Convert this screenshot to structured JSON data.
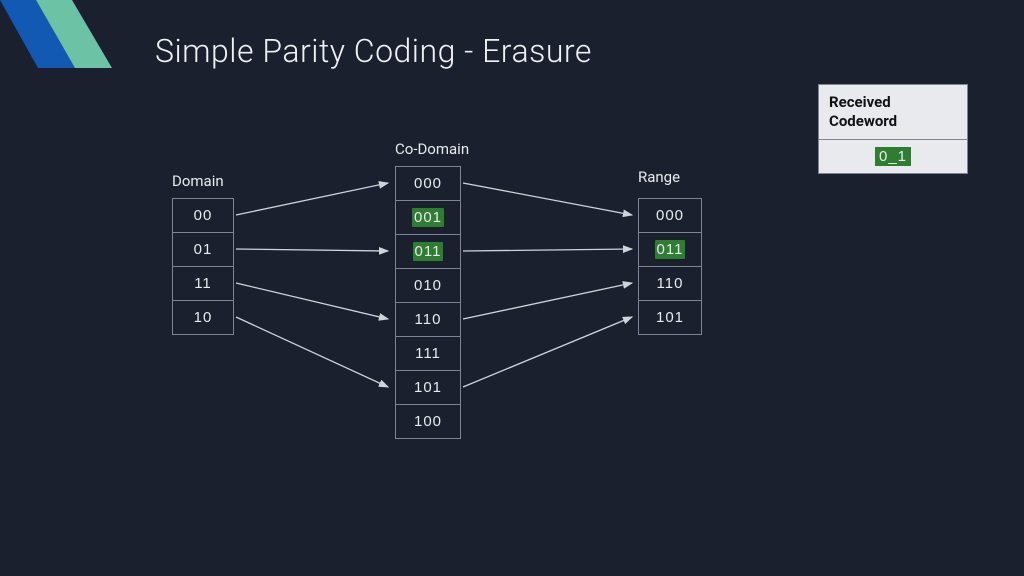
{
  "title": "Simple Parity Coding - Erasure",
  "labels": {
    "domain": "Domain",
    "codomain": "Co-Domain",
    "range": "Range"
  },
  "received": {
    "header": "Received Codeword",
    "value": "0_1"
  },
  "domain": {
    "items": [
      {
        "v": "00",
        "hl": false
      },
      {
        "v": "01",
        "hl": false
      },
      {
        "v": "11",
        "hl": false
      },
      {
        "v": "10",
        "hl": false
      }
    ]
  },
  "codomain": {
    "items": [
      {
        "v": "000",
        "hl": false
      },
      {
        "v": "001",
        "hl": true
      },
      {
        "v": "011",
        "hl": true
      },
      {
        "v": "010",
        "hl": false
      },
      {
        "v": "110",
        "hl": false
      },
      {
        "v": "111",
        "hl": false
      },
      {
        "v": "101",
        "hl": false
      },
      {
        "v": "100",
        "hl": false
      }
    ]
  },
  "range": {
    "items": [
      {
        "v": "000",
        "hl": false
      },
      {
        "v": "011",
        "hl": true
      },
      {
        "v": "110",
        "hl": false
      },
      {
        "v": "101",
        "hl": false
      }
    ]
  }
}
